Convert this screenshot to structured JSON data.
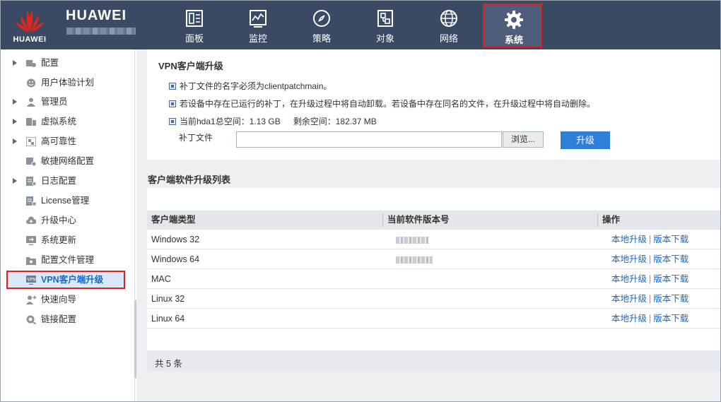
{
  "header": {
    "logo_text": "HUAWEI",
    "brand": "HUAWEI",
    "nav": [
      {
        "label": "面板",
        "icon": "dashboard-icon"
      },
      {
        "label": "监控",
        "icon": "monitor-icon"
      },
      {
        "label": "策略",
        "icon": "compass-icon"
      },
      {
        "label": "对象",
        "icon": "object-icon"
      },
      {
        "label": "网络",
        "icon": "globe-icon"
      },
      {
        "label": "系统",
        "icon": "gear-icon",
        "active": true
      }
    ]
  },
  "sidebar": {
    "items": [
      {
        "label": "配置",
        "expandable": true,
        "icon": "config-icon"
      },
      {
        "label": "用户体验计划",
        "expandable": false,
        "icon": "smiley-icon"
      },
      {
        "label": "管理员",
        "expandable": true,
        "icon": "admin-icon"
      },
      {
        "label": "虚拟系统",
        "expandable": true,
        "icon": "virtual-system-icon"
      },
      {
        "label": "高可靠性",
        "expandable": true,
        "icon": "high-availability-icon"
      },
      {
        "label": "敏捷网络配置",
        "expandable": false,
        "icon": "agile-network-icon"
      },
      {
        "label": "日志配置",
        "expandable": true,
        "icon": "log-icon"
      },
      {
        "label": "License管理",
        "expandable": false,
        "icon": "license-icon"
      },
      {
        "label": "升级中心",
        "expandable": false,
        "icon": "cloud-upgrade-icon"
      },
      {
        "label": "系统更新",
        "expandable": false,
        "icon": "system-update-icon"
      },
      {
        "label": "配置文件管理",
        "expandable": false,
        "icon": "config-file-icon"
      },
      {
        "label": "VPN客户端升级",
        "expandable": false,
        "icon": "vpn-icon",
        "active": true
      },
      {
        "label": "快速向导",
        "expandable": false,
        "icon": "wizard-icon"
      },
      {
        "label": "链接配置",
        "expandable": false,
        "icon": "link-config-icon"
      }
    ]
  },
  "upgrade": {
    "title": "VPN客户端升级",
    "notes": [
      "补丁文件的名字必须为clientpatchmain。",
      "若设备中存在已运行的补丁，在升级过程中将自动卸载。若设备中存在同名的文件，在升级过程中将自动删除。"
    ],
    "space_total_label": "当前hda1总空间：1.13 GB",
    "space_free_label": "剩余空间：182.37 MB",
    "file_label": "补丁文件",
    "file_value": "",
    "browse_label": "浏览...",
    "upgrade_label": "升级"
  },
  "list": {
    "title": "客户端软件升级列表",
    "columns": [
      "客户端类型",
      "当前软件版本号",
      "操作"
    ],
    "rows": [
      {
        "type": "Windows 32",
        "version_blurred": true
      },
      {
        "type": "Windows 64",
        "version_blurred": true
      },
      {
        "type": "MAC",
        "version_blurred": false
      },
      {
        "type": "Linux 32",
        "version_blurred": false
      },
      {
        "type": "Linux 64",
        "version_blurred": false
      }
    ],
    "action_local": "本地升级",
    "action_sep": "|",
    "action_download": "版本下载",
    "footer": "共 5 条"
  },
  "colors": {
    "header_bg": "#3a4a63",
    "accent": "#2f7fd9",
    "highlight_border": "#e02020",
    "link": "#1b68c2"
  }
}
